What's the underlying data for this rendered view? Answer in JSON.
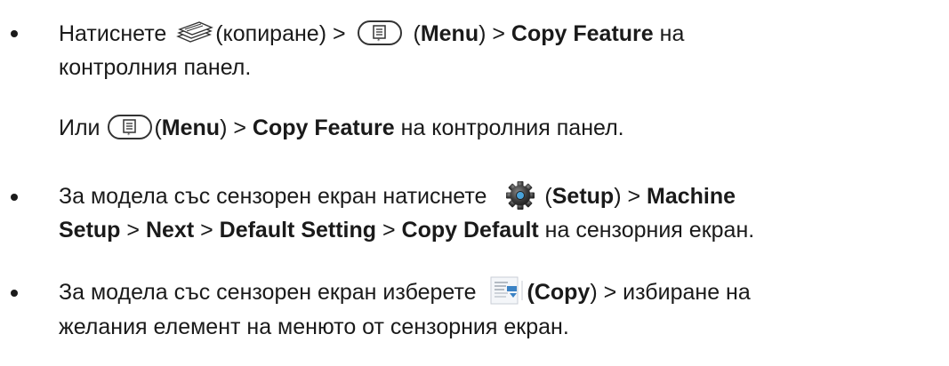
{
  "bullets": [
    {
      "line1": {
        "t1": "Натиснете ",
        "t2": "(копиране) > ",
        "t3": " (",
        "b1": "Menu",
        "t4": ") > ",
        "b2": "Copy Feature",
        "t5": " на"
      },
      "line2": {
        "t1": "контролния панел."
      },
      "alt": {
        "t1": "Или ",
        "t2": "(",
        "b1": "Menu",
        "t3": ") > ",
        "b2": "Copy Feature",
        "t4": " на контролния панел."
      }
    },
    {
      "line1": {
        "t1": "За модела със сензорен екран натиснете ",
        "t2": "(",
        "b1": "Setup",
        "t3": ") > ",
        "b2": "Machine"
      },
      "line2": {
        "b1": "Setup",
        "t1": " > ",
        "b2": "Next",
        "t2": " > ",
        "b3": "Default Setting",
        "t3": " > ",
        "b4": "Copy Default",
        "t4": " на сензорния екран."
      }
    },
    {
      "line1": {
        "t1": "За модела със сензорен екран изберете ",
        "b1": "(Copy",
        "t2": ") > избиране на"
      },
      "line2": {
        "t1": "желания елемент на менюто от сензорния екран."
      }
    }
  ],
  "icons": {
    "copy_button": "copy-tray-icon",
    "menu_button": "menu-button-icon",
    "setup": "gear-icon",
    "copy_touch": "copy-document-icon"
  },
  "colors": {
    "text": "#1a1a1a",
    "gear_body": "#3a3a3a",
    "gear_center": "#4aa3d9",
    "copy_accent": "#3b82c4"
  }
}
